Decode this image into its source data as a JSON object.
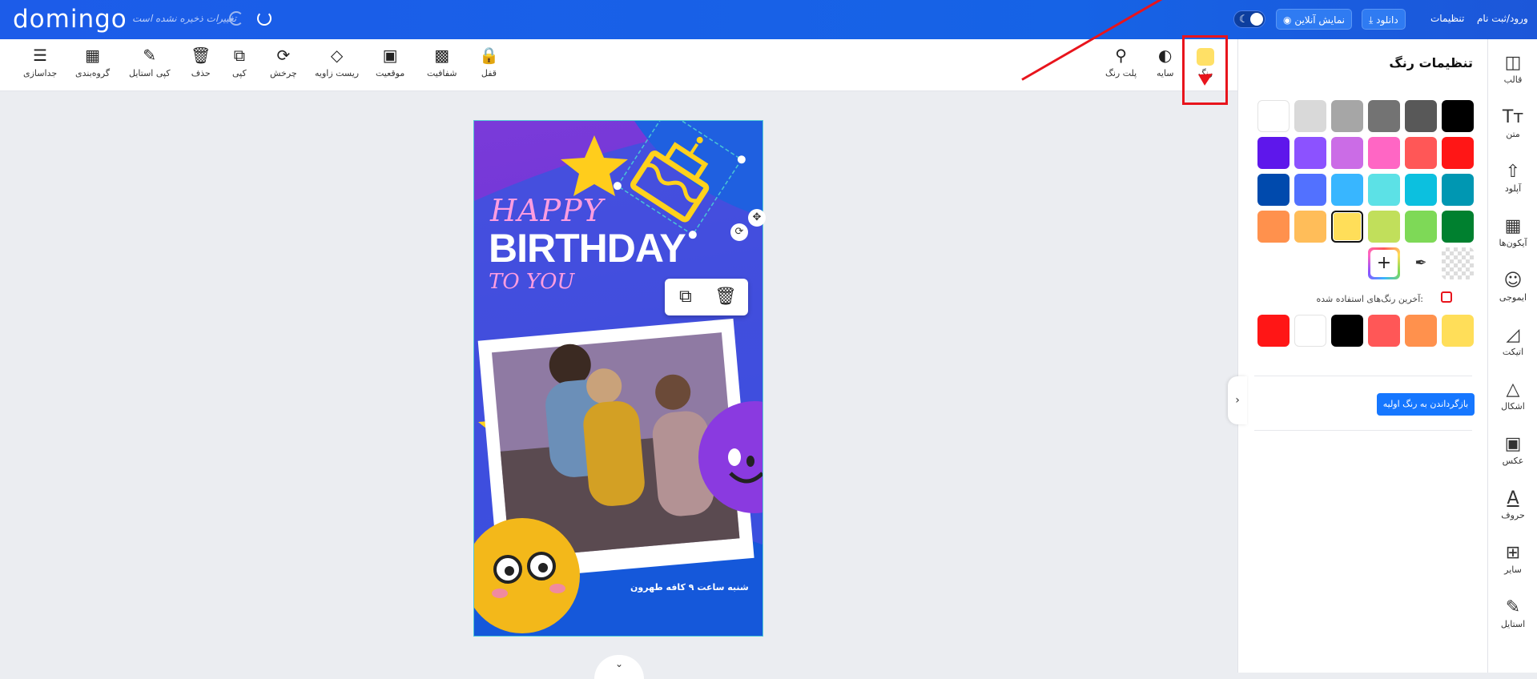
{
  "topbar": {
    "logo": "domingo",
    "unsaved_text": "تغییرات ذخیره نشده است",
    "download_label": "دانلود",
    "online_view_label": "نمایش آنلاین",
    "settings_label": "تنظیمات",
    "login_label": "ورود/ثبت نام"
  },
  "toolbar": {
    "right_tools": [
      {
        "label": "رنگ",
        "icon": "color-swatch-icon"
      },
      {
        "label": "سایه",
        "icon": "shadow-icon"
      },
      {
        "label": "پلت رنگ",
        "icon": "paint-bucket-icon"
      }
    ],
    "left_tools": [
      {
        "label": "قفل",
        "icon": "lock-icon"
      },
      {
        "label": "شفافیت",
        "icon": "transparency-icon"
      },
      {
        "label": "موقعیت",
        "icon": "position-icon"
      },
      {
        "label": "ریست زاویه",
        "icon": "reset-angle-icon"
      },
      {
        "label": "چرخش",
        "icon": "rotate-icon"
      },
      {
        "label": "کپی",
        "icon": "copy-icon"
      },
      {
        "label": "حذف",
        "icon": "trash-icon"
      },
      {
        "label": "کپی استایل",
        "icon": "paint-roller-icon"
      },
      {
        "label": "گروه‌بندی",
        "icon": "group-icon"
      },
      {
        "label": "جداسازی",
        "icon": "ungroup-icon"
      }
    ],
    "selected_color": "#ffe066"
  },
  "canvas": {
    "happy": "HAPPY",
    "birthday": "BIRTHDAY",
    "to_you": "TO YOU",
    "caption": "شنبه ساعت ۹ کافه طهرون"
  },
  "color_panel": {
    "title": "تنظیمات رنگ",
    "palette": [
      [
        "#000000",
        "#585858",
        "#737373",
        "#a6a6a6",
        "#d9d9d9",
        "#ffffff"
      ],
      [
        "#ff1616",
        "#ff5757",
        "#ff66c4",
        "#cb6ce6",
        "#8c52ff",
        "#5e17eb"
      ],
      [
        "#0097b2",
        "#0cc0df",
        "#5ce1e6",
        "#38b6ff",
        "#5271ff",
        "#004aad"
      ],
      [
        "#00802f",
        "#7ed957",
        "#c1df5b",
        "#ffde59",
        "#ffbd59",
        "#ff914d"
      ]
    ],
    "selected_swatch": "#ffde59",
    "recent_label": "آخرین رنگ‌های استفاده شده:",
    "recent_colors": [
      "#ffde59",
      "#ff914d",
      "#ff5757",
      "#000000",
      "#ffffff",
      "#ff1616"
    ],
    "reset_label": "بازگرداندن به رنگ اولیه"
  },
  "right_sidebar": [
    {
      "label": "قالب",
      "icon": "template-icon"
    },
    {
      "label": "متن",
      "icon": "text-icon"
    },
    {
      "label": "آپلود",
      "icon": "upload-icon"
    },
    {
      "label": "آیکون‌ها",
      "icon": "icons-icon"
    },
    {
      "label": "ایموجی",
      "icon": "emoji-icon"
    },
    {
      "label": "اتیکت",
      "icon": "tag-icon"
    },
    {
      "label": "اشکال",
      "icon": "shapes-icon"
    },
    {
      "label": "عکس",
      "icon": "image-icon"
    },
    {
      "label": "حروف",
      "icon": "letters-icon"
    },
    {
      "label": "سایر",
      "icon": "more-icon"
    },
    {
      "label": "استایل",
      "icon": "style-icon"
    }
  ]
}
